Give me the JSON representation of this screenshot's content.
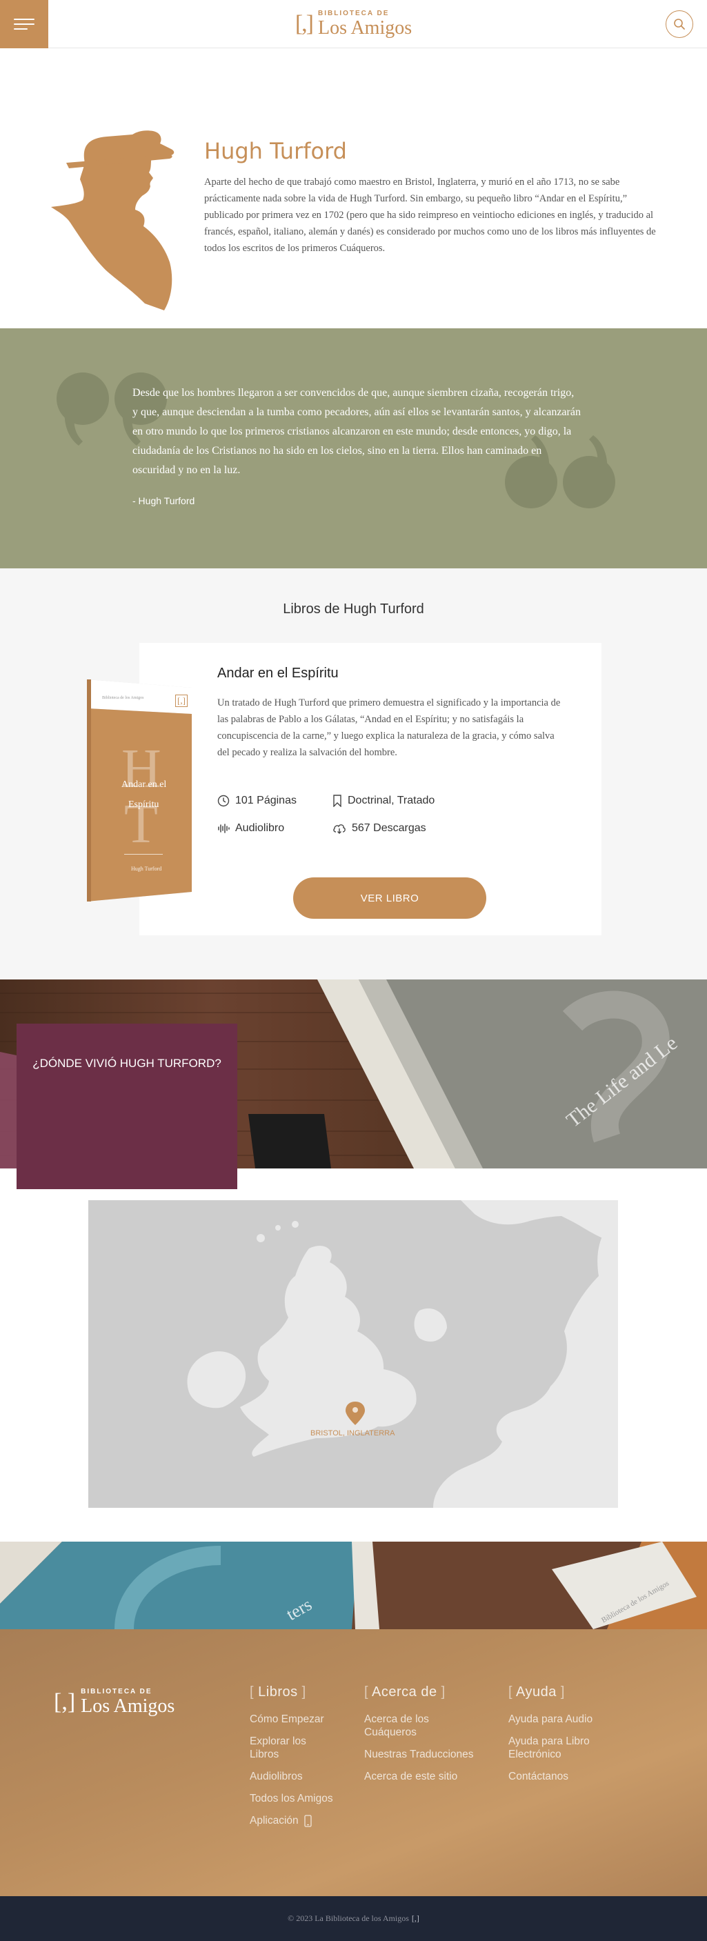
{
  "header": {
    "logo_small": "BIBLIOTECA DE",
    "logo_big": "Los Amigos",
    "logo_mark": "[,]"
  },
  "author": {
    "name": "Hugh Turford",
    "bio": "Aparte del hecho de que trabajó como maestro en Bristol, Inglaterra, y murió en el año 1713, no se sabe prácticamente nada sobre la vida de Hugh Turford. Sin embargo, su pequeño libro “Andar en el Espíritu,” publicado por primera vez en 1702 (pero que ha sido reimpreso en veintiocho ediciones en inglés, y traducido al francés, español, italiano, alemán y danés) es considerado por muchos como uno de los libros más influyentes de todos los escritos de los primeros Cuáqueros."
  },
  "quote": {
    "text": "Desde que los hombres llegaron a ser convencidos de que, aunque siembren cizaña, recogerán trigo, y que, aunque desciendan a la tumba como pecadores, aún así ellos se levantarán santos, y alcanzarán en otro mundo lo que los primeros cristianos alcanzaron en este mundo; desde entonces, yo digo, la ciudadanía de los Cristianos no ha sido en los cielos, sino en la tierra. Ellos han caminado en oscuridad y no en la luz.",
    "author": "- Hugh Turford"
  },
  "books": {
    "section_title": "Libros de Hugh Turford",
    "items": [
      {
        "title": "Andar en el Espíritu",
        "description": "Un tratado de Hugh Turford que primero demuestra el significado y la importancia de las palabras de Pablo a los Gálatas, “Andad en el Espíritu; y no satisfagáis la concupiscencia de la carne,” y luego explica la naturaleza de la gracia, y cómo salva del pecado y realiza la salvación del hombre.",
        "pages": "101 Páginas",
        "category": "Doctrinal, Tratado",
        "audio": "Audiolibro",
        "downloads": "567 Descargas",
        "button": "VER LIBRO",
        "cover": {
          "header": "Biblioteca de los Amigos",
          "mark": "[,]",
          "initial_top": "H",
          "initial_bottom": "T",
          "title_line1": "Andar en el",
          "title_line2": "Espíritu",
          "author": "Hugh Turford"
        }
      }
    ]
  },
  "where": {
    "title": "¿DÓNDE VIVIÓ HUGH TURFORD?",
    "bg_book_text": "The Life and Le",
    "map_label": "BRISTOL, INGLATERRA"
  },
  "decor": {
    "book_spine_text": "Biblioteca de los Amigos",
    "teal_book_text": "ters"
  },
  "footer": {
    "logo_small": "BIBLIOTECA DE",
    "logo_big": "Los Amigos",
    "columns": [
      {
        "heading": "Libros",
        "links": [
          "Cómo Empezar",
          "Explorar los Libros",
          "Audiolibros",
          "Todos los Amigos",
          "Aplicación"
        ]
      },
      {
        "heading": "Acerca de",
        "links": [
          "Acerca de los Cuáqueros",
          "Nuestras Traducciones",
          "Acerca de este sitio"
        ]
      },
      {
        "heading": "Ayuda",
        "links": [
          "Ayuda para Audio",
          "Ayuda para Libro Electrónico",
          "Contáctanos"
        ]
      }
    ],
    "copyright": "© 2023 La Biblioteca de los Amigos",
    "copyright_mark": "[,]"
  },
  "colors": {
    "accent": "#c68f58",
    "quote_band": "#9a9e7c",
    "where_box": "#6c2f47",
    "footer_bottom": "#1f2636"
  }
}
